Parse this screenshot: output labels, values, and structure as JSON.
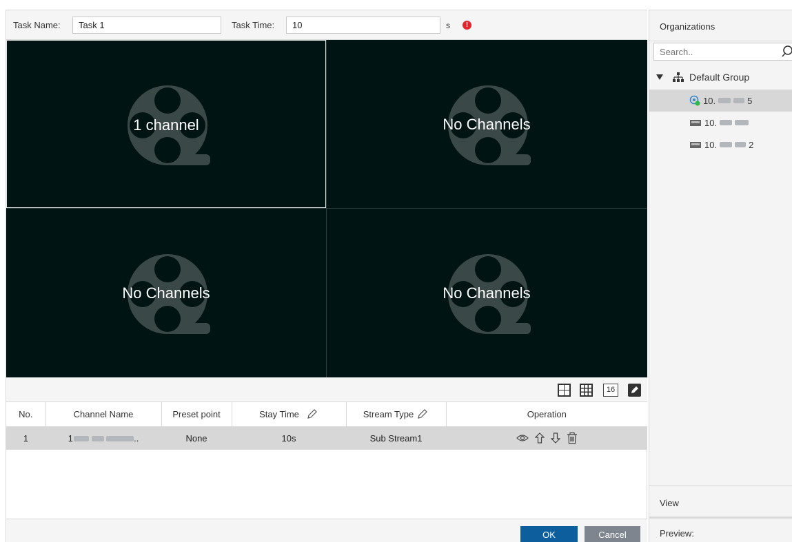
{
  "task": {
    "name_label": "Task Name:",
    "name_value": "Task 1",
    "time_label": "Task Time:",
    "time_value": "10",
    "time_unit": "s"
  },
  "grid": {
    "cells": [
      {
        "label": "1 channel"
      },
      {
        "label": "No Channels"
      },
      {
        "label": "No Channels"
      },
      {
        "label": "No Channels"
      }
    ]
  },
  "layout_buttons": {
    "sixteen": "16"
  },
  "table": {
    "headers": {
      "no": "No.",
      "channel_name": "Channel Name",
      "preset_point": "Preset point",
      "stay_time": "Stay Time",
      "stream_type": "Stream Type",
      "operation": "Operation"
    },
    "rows": [
      {
        "no": "1",
        "channel_name_prefix": "1",
        "channel_name_suffix": "..",
        "preset_point": "None",
        "stay_time": "10s",
        "stream_type": "Sub Stream1"
      }
    ]
  },
  "footer": {
    "ok": "OK",
    "cancel": "Cancel"
  },
  "sidebar": {
    "organizations": "Organizations",
    "search_placeholder": "Search..",
    "group": "Default Group",
    "devices": [
      {
        "prefix": "10.",
        "suffix": "5"
      },
      {
        "prefix": "10.",
        "suffix": ""
      },
      {
        "prefix": "10.",
        "suffix": "2"
      }
    ],
    "view": "View",
    "preview": "Preview:"
  },
  "colors": {
    "grid_bg": "#001414",
    "primary": "#0c5e9c",
    "secondary": "#7e858f",
    "warning": "#e0262b",
    "online": "#2fb84a"
  }
}
